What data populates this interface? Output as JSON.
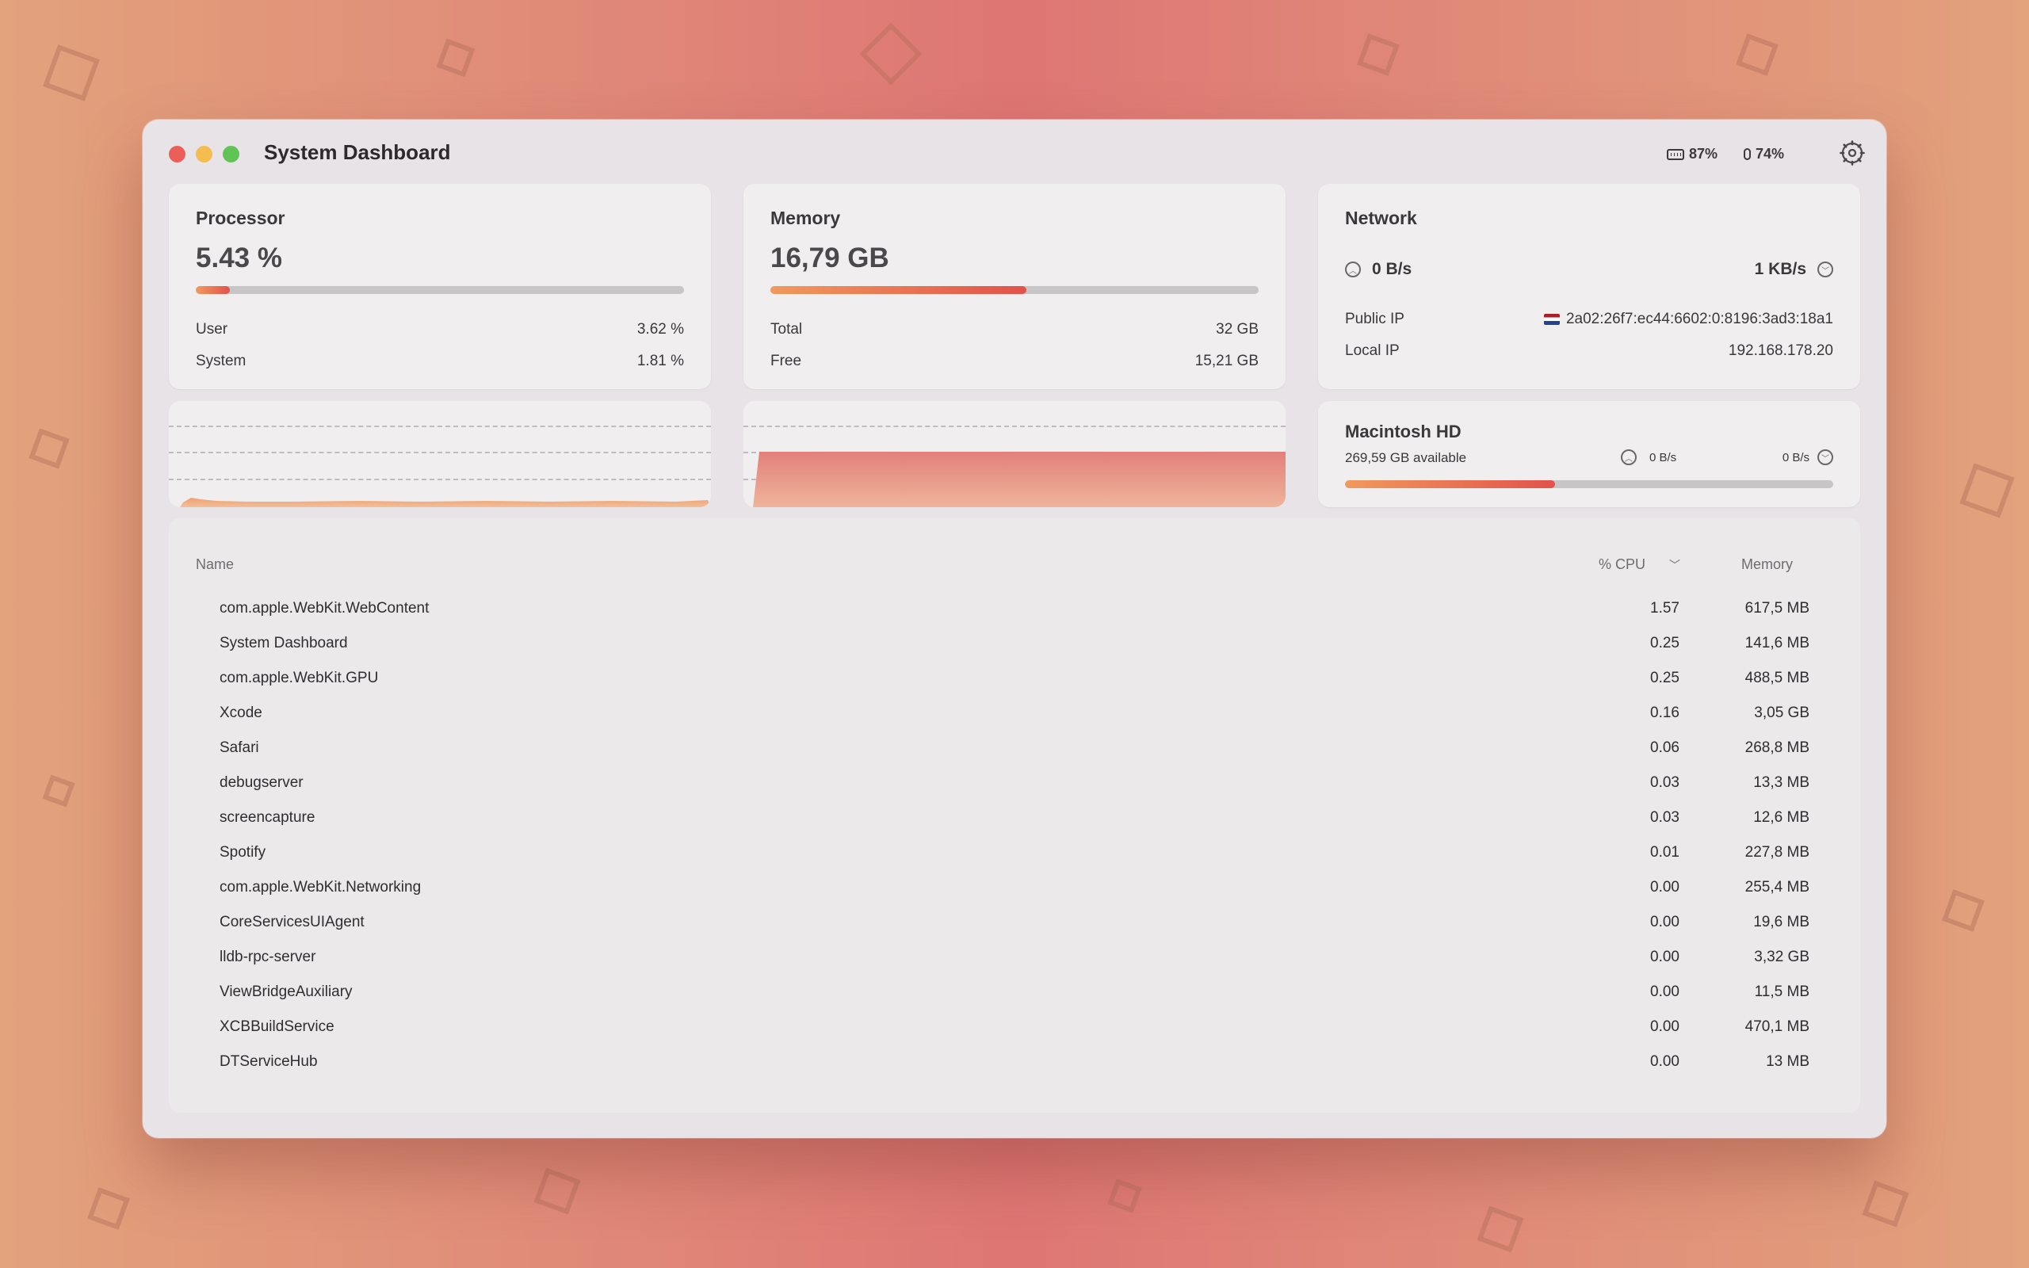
{
  "window": {
    "title": "System Dashboard"
  },
  "status": {
    "keyboard_battery": "87%",
    "mouse_battery": "74%"
  },
  "processor": {
    "title": "Processor",
    "value": "5.43 %",
    "usage_fraction": 0.0543,
    "rows": [
      {
        "label": "User",
        "value": "3.62 %"
      },
      {
        "label": "System",
        "value": "1.81 %"
      }
    ]
  },
  "memory": {
    "title": "Memory",
    "value": "16,79 GB",
    "usage_fraction": 0.525,
    "rows": [
      {
        "label": "Total",
        "value": "32 GB"
      },
      {
        "label": "Free",
        "value": "15,21 GB"
      }
    ]
  },
  "network": {
    "title": "Network",
    "upload": "0 B/s",
    "download": "1 KB/s",
    "rows": [
      {
        "label": "Public IP",
        "value": "2a02:26f7:ec44:6602:0:8196:3ad3:18a1"
      },
      {
        "label": "Local IP",
        "value": "192.168.178.20"
      }
    ]
  },
  "disk": {
    "title": "Macintosh HD",
    "available": "269,59 GB available",
    "read": "0 B/s",
    "write": "0 B/s",
    "usage_fraction": 0.43
  },
  "table": {
    "headers": {
      "name": "Name",
      "cpu": "% CPU",
      "memory": "Memory"
    },
    "rows": [
      {
        "name": "com.apple.WebKit.WebContent",
        "cpu": "1.57",
        "memory": "617,5 MB"
      },
      {
        "name": "System Dashboard",
        "cpu": "0.25",
        "memory": "141,6 MB"
      },
      {
        "name": "com.apple.WebKit.GPU",
        "cpu": "0.25",
        "memory": "488,5 MB"
      },
      {
        "name": "Xcode",
        "cpu": "0.16",
        "memory": "3,05 GB"
      },
      {
        "name": "Safari",
        "cpu": "0.06",
        "memory": "268,8 MB"
      },
      {
        "name": "debugserver",
        "cpu": "0.03",
        "memory": "13,3 MB"
      },
      {
        "name": "screencapture",
        "cpu": "0.03",
        "memory": "12,6 MB"
      },
      {
        "name": "Spotify",
        "cpu": "0.01",
        "memory": "227,8 MB"
      },
      {
        "name": "com.apple.WebKit.Networking",
        "cpu": "0.00",
        "memory": "255,4 MB"
      },
      {
        "name": "CoreServicesUIAgent",
        "cpu": "0.00",
        "memory": "19,6 MB"
      },
      {
        "name": "lldb-rpc-server",
        "cpu": "0.00",
        "memory": "3,32 GB"
      },
      {
        "name": "ViewBridgeAuxiliary",
        "cpu": "0.00",
        "memory": "11,5 MB"
      },
      {
        "name": "XCBBuildService",
        "cpu": "0.00",
        "memory": "470,1 MB"
      },
      {
        "name": "DTServiceHub",
        "cpu": "0.00",
        "memory": "13 MB"
      }
    ]
  },
  "colors": {
    "accent_start": "#f09a5c",
    "accent_end": "#e2524b",
    "window_bg": "#e8e3e6",
    "card_bg": "#f1eef0"
  }
}
